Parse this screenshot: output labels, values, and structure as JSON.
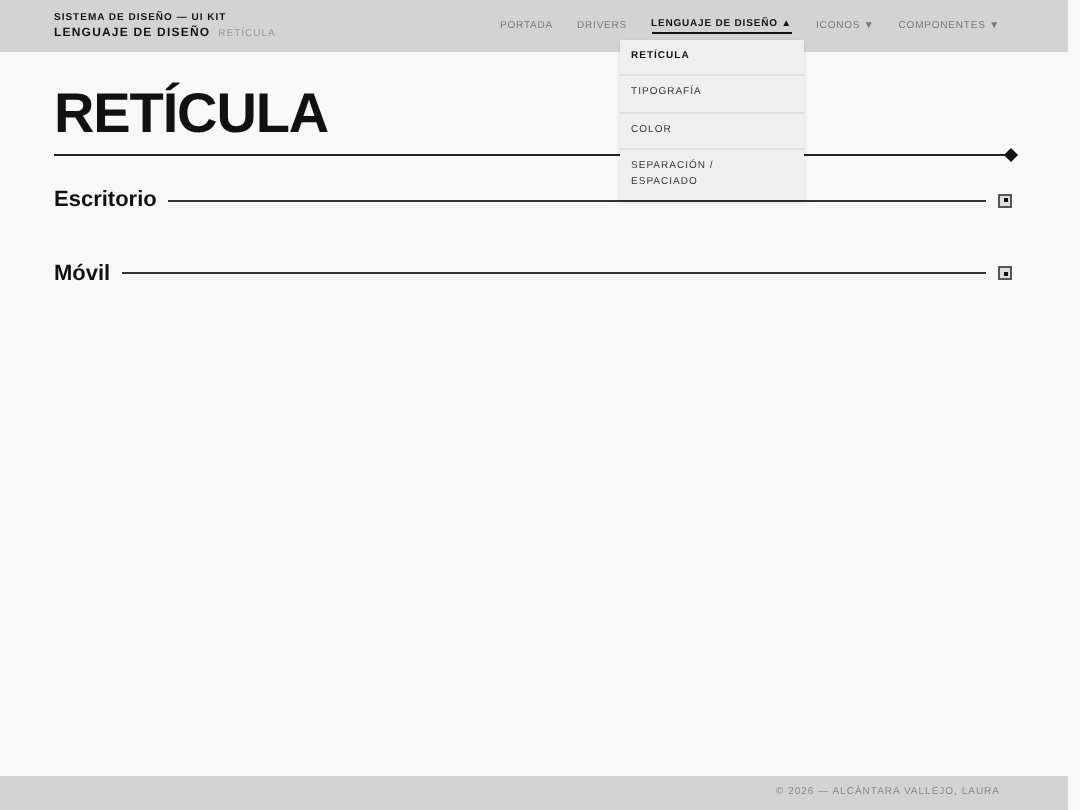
{
  "header": {
    "kicker": "SISTEMA DE DISEÑO — UI KIT",
    "section": "LENGUAJE DE DISEÑO",
    "current": "RETÍCULA"
  },
  "nav": [
    {
      "label": "PORTADA",
      "selected": false
    },
    {
      "label": "DRIVERS",
      "selected": false
    },
    {
      "label": "LENGUAJE DE DISEÑO",
      "caret": "▲",
      "selected": true,
      "expanded": true,
      "menu": [
        {
          "label": "RETÍCULA",
          "selected": true
        },
        {
          "label": "TIPOGRAFÍA",
          "selected": false
        },
        {
          "label": "COLOR",
          "selected": false
        },
        {
          "label": "SEPARACIÓN / ESPACIADO",
          "selected": false
        }
      ]
    },
    {
      "label": "ICONOS",
      "caret": "▼",
      "selected": false
    },
    {
      "label": "COMPONENTES",
      "caret": "▼",
      "selected": false
    }
  ],
  "title": "RETÍCULA",
  "sections": [
    {
      "label": "Escritorio",
      "expanded": false
    },
    {
      "label": "Móvil",
      "expanded": false
    }
  ],
  "footer": "© 2026 — ALCÁNTARA VALLEJO, LAURA"
}
